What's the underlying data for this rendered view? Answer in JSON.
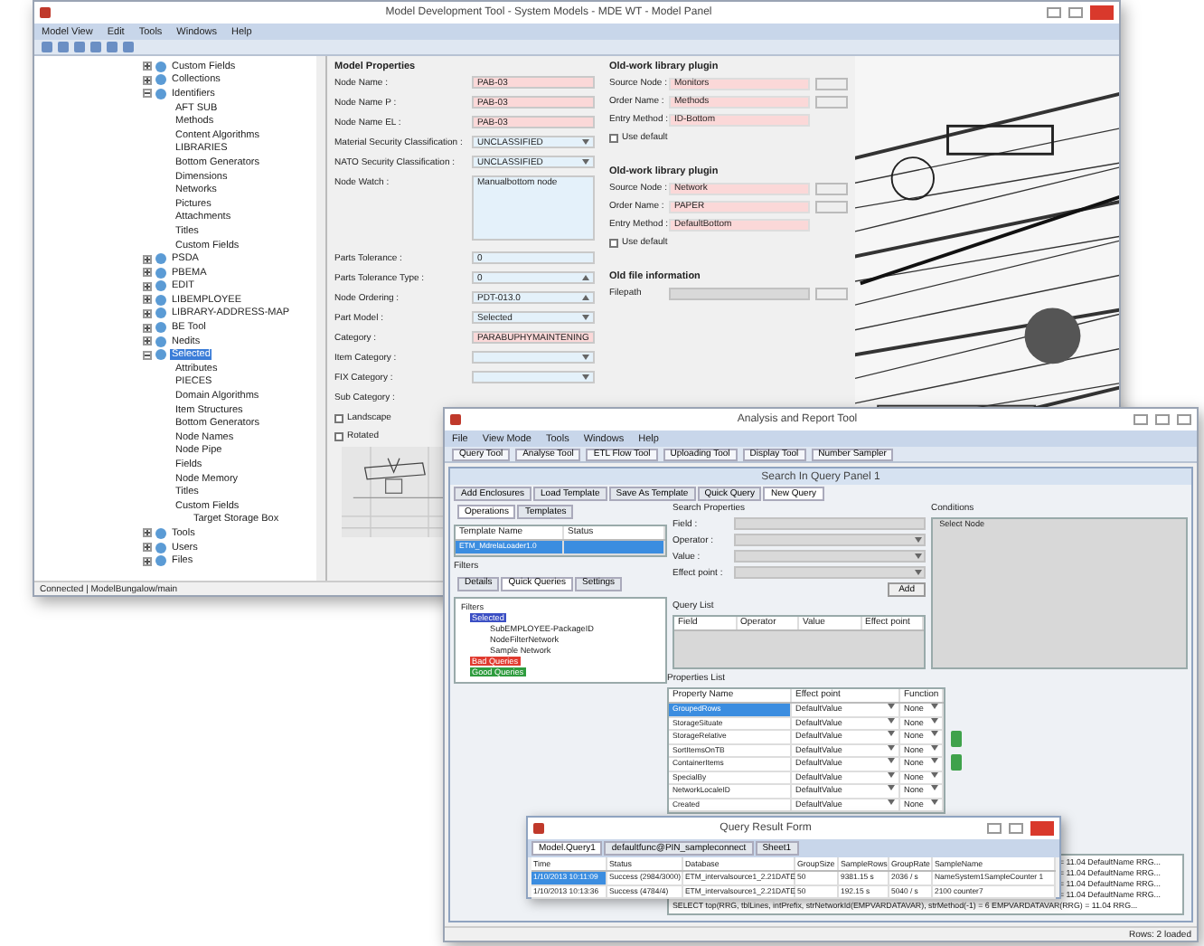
{
  "main_window": {
    "title": "Model Development Tool - System Models - MDE WT - Model Panel",
    "menu": [
      "Model View",
      "Edit",
      "Tools",
      "Windows",
      "Help"
    ],
    "tree": [
      {
        "label": "Custom Fields",
        "expanded": false,
        "selected": false
      },
      {
        "label": "Collections",
        "expanded": false,
        "selected": false
      },
      {
        "label": "Identifiers",
        "expanded": true,
        "selected": false,
        "children": [
          {
            "label": "AFT SUB"
          },
          {
            "label": "Methods"
          },
          {
            "label": "Content Algorithms"
          },
          {
            "label": "LIBRARIES"
          },
          {
            "label": "Bottom Generators"
          },
          {
            "label": "Dimensions"
          },
          {
            "label": "Networks"
          },
          {
            "label": "Pictures"
          },
          {
            "label": "Attachments"
          },
          {
            "label": "Titles"
          },
          {
            "label": "Custom Fields"
          }
        ]
      },
      {
        "label": "PSDA",
        "expanded": false,
        "selected": false
      },
      {
        "label": "PBEMA",
        "expanded": false,
        "selected": false
      },
      {
        "label": "EDIT",
        "expanded": false,
        "selected": false
      },
      {
        "label": "LIBEMPLOYEE",
        "expanded": false,
        "selected": false
      },
      {
        "label": "LIBRARY-ADDRESS-MAP",
        "expanded": false,
        "selected": false
      },
      {
        "label": "BE Tool",
        "expanded": false,
        "selected": false
      },
      {
        "label": "Nedits",
        "expanded": false,
        "selected": false
      },
      {
        "label": "Selected",
        "expanded": true,
        "selected": true,
        "children": [
          {
            "label": "Attributes"
          },
          {
            "label": "PIECES"
          },
          {
            "label": "Domain Algorithms"
          },
          {
            "label": "Item Structures"
          },
          {
            "label": "Bottom Generators"
          },
          {
            "label": "Node Names"
          },
          {
            "label": "Node Pipe"
          },
          {
            "label": "Fields"
          },
          {
            "label": "Node Memory"
          },
          {
            "label": "Titles"
          },
          {
            "label": "Custom Fields",
            "children": [
              {
                "label": "Target Storage Box"
              }
            ]
          }
        ]
      },
      {
        "label": "Tools",
        "expanded": false,
        "selected": false
      },
      {
        "label": "Users",
        "expanded": false,
        "selected": false
      },
      {
        "label": "Files",
        "expanded": false,
        "selected": false
      }
    ],
    "properties": {
      "heading": "Model Properties",
      "fields": [
        {
          "label": "Node Name :",
          "value": "PAB-03",
          "kind": "text",
          "required": true
        },
        {
          "label": "Node Name P :",
          "value": "PAB-03",
          "kind": "text",
          "required": true
        },
        {
          "label": "Node Name EL :",
          "value": "PAB-03",
          "kind": "text",
          "required": true
        },
        {
          "label": "Material Security Classification :",
          "value": "UNCLASSIFIED",
          "kind": "select",
          "required": false
        },
        {
          "label": "NATO Security Classification :",
          "value": "UNCLASSIFIED",
          "kind": "select",
          "required": false
        },
        {
          "label": "Node Watch :",
          "value": "Manualbottom node",
          "kind": "textarea",
          "required": false
        },
        {
          "label": "Parts Tolerance :",
          "value": "0",
          "kind": "text",
          "required": false
        },
        {
          "label": "Parts Tolerance Type :",
          "value": "0",
          "kind": "spin",
          "required": false
        },
        {
          "label": "Node Ordering :",
          "value": "PDT-013.0",
          "kind": "spin",
          "required": false
        },
        {
          "label": "Part Model :",
          "value": "Selected",
          "kind": "select",
          "required": false
        },
        {
          "label": "Category :",
          "value": "PARABUPHYMAINTENING",
          "kind": "text",
          "required": true
        },
        {
          "label": "Item Category :",
          "kind": "select",
          "required": false
        },
        {
          "label": "FIX Category :",
          "kind": "select",
          "required": false
        },
        {
          "label": "Sub Category :",
          "kind": "none",
          "required": false
        }
      ],
      "checkboxes": [
        {
          "label": "Landscape",
          "checked": false
        },
        {
          "label": "Rotated",
          "checked": false
        }
      ]
    },
    "plugins": [
      {
        "heading": "Old-work library plugin",
        "fields": [
          {
            "label": "Source Node :",
            "value": "Monitors"
          },
          {
            "label": "Order Name :",
            "value": "Methods"
          },
          {
            "label": "Entry Method :",
            "value": "ID-Bottom"
          }
        ],
        "option": {
          "label": "Use default",
          "checked": false
        }
      },
      {
        "heading": "Old-work library plugin",
        "fields": [
          {
            "label": "Source Node :",
            "value": "Network"
          },
          {
            "label": "Order Name :",
            "value": "PAPER"
          },
          {
            "label": "Entry Method :",
            "value": "DefaultBottom"
          }
        ],
        "option": {
          "label": "Use default",
          "checked": false
        }
      }
    ],
    "file_info": {
      "heading": "Old file information",
      "label": "Filepath"
    },
    "status": "Connected | ModelBungalow/main"
  },
  "report_window": {
    "title": "Analysis and Report Tool",
    "menu": [
      "File",
      "View Mode",
      "Tools",
      "Windows",
      "Help"
    ],
    "toolbar": [
      "Query Tool",
      "Analyse Tool",
      "ETL Flow Tool",
      "Uploading Tool",
      "Display Tool",
      "Number Sampler"
    ],
    "panel_title": "Search In Query Panel 1",
    "panel_tabs": [
      {
        "label": "Add Enclosures",
        "selected": false
      },
      {
        "label": "Load Template",
        "selected": false
      },
      {
        "label": "Save As Template",
        "selected": false
      },
      {
        "label": "Quick Query",
        "selected": false
      },
      {
        "label": "New Query",
        "selected": true
      }
    ],
    "list_tabs": [
      {
        "label": "Operations",
        "selected": true
      },
      {
        "label": "Templates",
        "selected": false
      }
    ],
    "list_columns": [
      "Template Name",
      "Status"
    ],
    "list_rows": [
      {
        "name": "ETM_MdrelaLoader1.0",
        "status": "",
        "selected": true
      }
    ],
    "filters_heading": "Filters",
    "filter_tabs": [
      {
        "label": "Details",
        "selected": false
      },
      {
        "label": "Quick Queries",
        "selected": true
      },
      {
        "label": "Settings",
        "selected": false
      }
    ],
    "filter_tree": {
      "label": "Filters",
      "children": [
        {
          "label": "Selected",
          "color": "#3b4fc4",
          "children": [
            {
              "label": "SubEMPLOYEE-PackageID"
            },
            {
              "label": "NodeFilterNetwork"
            },
            {
              "label": "Sample Network"
            }
          ]
        },
        {
          "label": "Bad Queries",
          "color": "#e03a2f"
        },
        {
          "label": "Good Queries",
          "color": "#2e9c3e"
        }
      ]
    },
    "search": {
      "heading": "Search Properties",
      "fields": [
        {
          "label": "Field :",
          "kind": "text"
        },
        {
          "label": "Operator :",
          "kind": "select"
        },
        {
          "label": "Value :",
          "kind": "select"
        },
        {
          "label": "Effect point :",
          "kind": "select"
        }
      ],
      "button": "Add"
    },
    "query_list": {
      "heading": "Query List",
      "columns": [
        "Field",
        "Operator",
        "Value",
        "Effect point"
      ]
    },
    "conditions": {
      "heading": "Conditions",
      "item": "Select Node"
    },
    "property_list": {
      "heading": "Properties List",
      "columns": [
        "Property Name",
        "Effect point",
        "Function"
      ],
      "rows": [
        {
          "name": "GroupedRows",
          "effect": "DefaultValue",
          "function": "None",
          "selected": true
        },
        {
          "name": "StorageSituate",
          "effect": "DefaultValue",
          "function": "None",
          "selected": false
        },
        {
          "name": "StorageRelative",
          "effect": "DefaultValue",
          "function": "None",
          "selected": false
        },
        {
          "name": "SortItemsOnTB",
          "effect": "DefaultValue",
          "function": "None",
          "selected": false
        },
        {
          "name": "ContainerItems",
          "effect": "DefaultValue",
          "function": "None",
          "selected": false
        },
        {
          "name": "SpecialBy",
          "effect": "DefaultValue",
          "function": "None",
          "selected": false
        },
        {
          "name": "NetworkLocaleID",
          "effect": "DefaultValue",
          "function": "None",
          "selected": false
        },
        {
          "name": "Created",
          "effect": "DefaultValue",
          "function": "None",
          "selected": false
        }
      ]
    },
    "sql_lines": [
      "= 11.04 DefaultName RRG...",
      "= 11.04 DefaultName RRG...",
      "= 11.04 DefaultName RRG...",
      "= 11.04 DefaultName RRG...",
      "SELECT top(RRG, tblLines, intPrefix, strNetworkId(EMPVARDATAVAR), strMethod(-1) = 6 EMPVARDATAVAR(RRG) = 11.04 RRG..."
    ],
    "status": "Rows: 2 loaded",
    "result_form": {
      "title": "Query Result Form",
      "tabs": [
        {
          "label": "Model.Query1",
          "selected": true
        },
        {
          "label": "defaultfunc@PIN_sampleconnect",
          "selected": false
        },
        {
          "label": "Sheet1",
          "selected": false
        }
      ],
      "columns": [
        "Time",
        "Status",
        "Database",
        "GroupSize",
        "SampleRows",
        "GroupRate",
        "SampleName"
      ],
      "rows": [
        {
          "cells": [
            "1/10/2013 10:11:09",
            "Success (2984/3000)",
            "ETM_intervalsource1_2.21DATE",
            "50",
            "9381.15 s",
            "2036 / s",
            "NameSystem1SampleCounter 1"
          ],
          "selected": true
        },
        {
          "cells": [
            "1/10/2013 10:13:36",
            "Success (4784/4)",
            "ETM_intervalsource1_2.21DATE",
            "50",
            "192.15 s",
            "5040 / s",
            "2100 counter7"
          ],
          "selected": false
        }
      ]
    }
  }
}
